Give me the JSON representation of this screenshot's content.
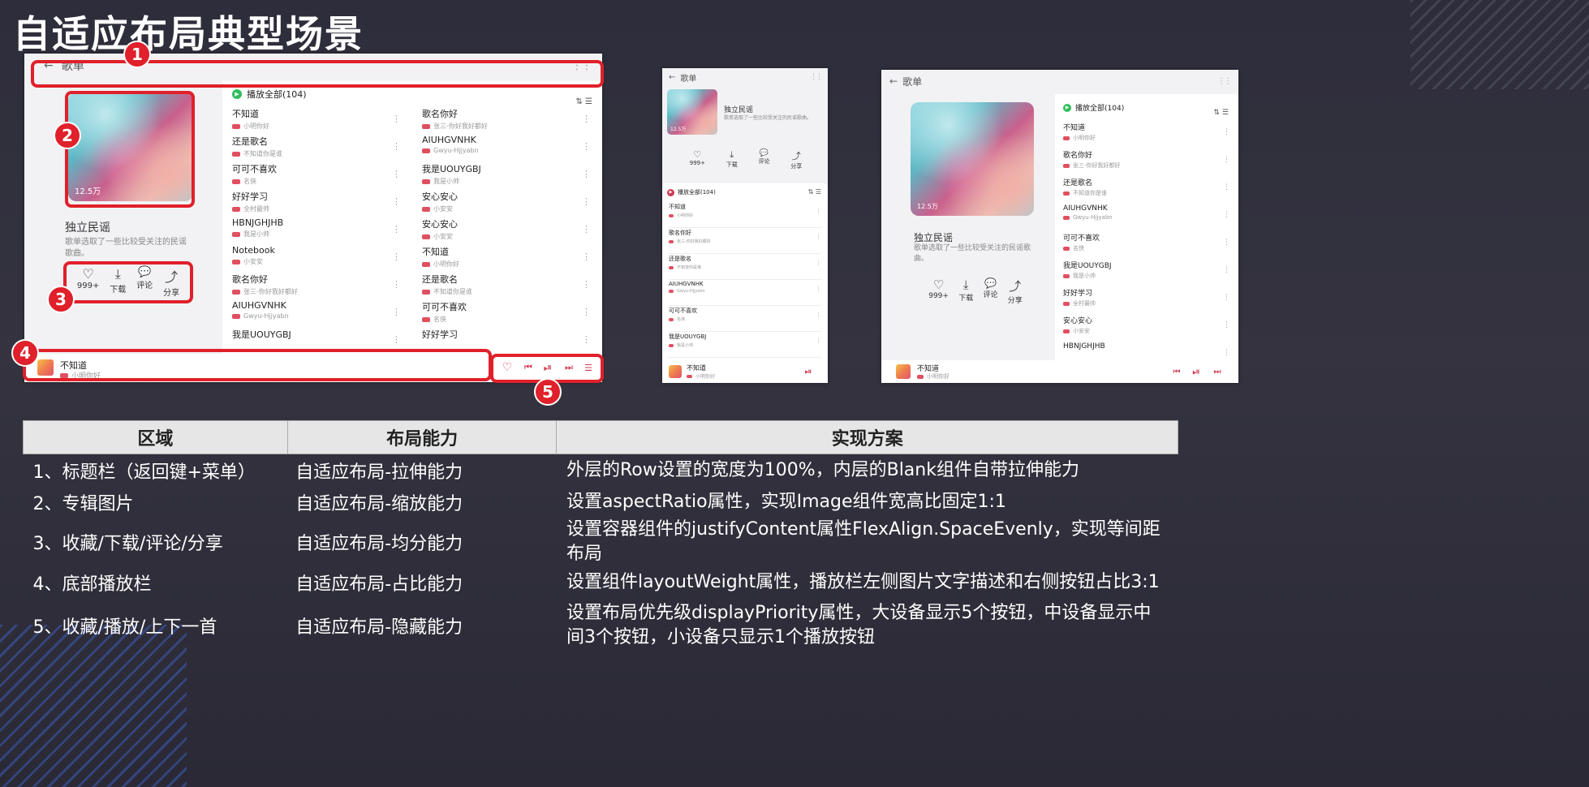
{
  "slide_title": "自适应布局典型场景",
  "large": {
    "header": {
      "back_icon": "←",
      "title": "歌单",
      "menu_icon": "⋮⋮"
    },
    "album": {
      "play_count": "12.5万",
      "name": "独立民谣",
      "desc_line1": "歌单选取了一些比较受关注的民谣",
      "desc_line2": "歌曲。"
    },
    "actions": [
      {
        "icon": "♡",
        "label": "999+"
      },
      {
        "icon": "⤓",
        "label": "下载"
      },
      {
        "icon": "💬",
        "label": "评论"
      },
      {
        "icon": "⤴",
        "label": "分享"
      }
    ],
    "play_all": "播放全部(104)",
    "list_icons": "⇅ ☰",
    "col1": [
      {
        "title": "不知道",
        "sub": "小明你好"
      },
      {
        "title": "还是歌名",
        "sub": "不知道你是谁"
      },
      {
        "title": "可可不喜欢",
        "sub": "名侠"
      },
      {
        "title": "好好学习",
        "sub": "全村最帅"
      },
      {
        "title": "HBNJGHJHB",
        "sub": "我是小帅"
      },
      {
        "title": "Notebook",
        "sub": "小安安"
      },
      {
        "title": "歌名你好",
        "sub": "张三-你好我好都好"
      },
      {
        "title": "AIUHGVNHK",
        "sub": "Gwyu-Hjjyabn"
      },
      {
        "title": "我是UOUYGBJ",
        "sub": ""
      }
    ],
    "col2": [
      {
        "title": "歌名你好",
        "sub": "张三-你好我好都好"
      },
      {
        "title": "AIUHGVNHK",
        "sub": "Gwyu-Hjjyabn"
      },
      {
        "title": "我是UOUYGBJ",
        "sub": "我是小帅"
      },
      {
        "title": "安心安心",
        "sub": "小安安"
      },
      {
        "title": "安心安心",
        "sub": "小安安"
      },
      {
        "title": "不知道",
        "sub": "小明你好"
      },
      {
        "title": "还是歌名",
        "sub": "不知道你是谁"
      },
      {
        "title": "可可不喜欢",
        "sub": "名侠"
      },
      {
        "title": "好好学习",
        "sub": ""
      }
    ],
    "player": {
      "title": "不知道",
      "sub": "小明你好"
    },
    "controls": [
      "♡",
      "⏮",
      "⏯",
      "⏭",
      "☰"
    ]
  },
  "small": {
    "header": {
      "back_icon": "←",
      "title": "歌单",
      "menu_icon": "⋮⋮"
    },
    "album": {
      "play_count": "12.5万",
      "name": "独立民谣",
      "desc": "歌单选取了一些比较受关注的民谣歌曲。"
    },
    "actions": [
      {
        "icon": "♡",
        "label": "999+"
      },
      {
        "icon": "⤓",
        "label": "下载"
      },
      {
        "icon": "💬",
        "label": "评论"
      },
      {
        "icon": "⤴",
        "label": "分享"
      }
    ],
    "play_all": "播放全部(104)",
    "list_icons": "⇅ ☰",
    "songs": [
      {
        "title": "不知道",
        "sub": "小明你好"
      },
      {
        "title": "歌名你好",
        "sub": "张三-你好我好都好"
      },
      {
        "title": "还是歌名",
        "sub": "不知道你是谁"
      },
      {
        "title": "AIUHGVNHK",
        "sub": "Gwyu-Hjjyabn"
      },
      {
        "title": "可可不喜欢",
        "sub": "名侠"
      },
      {
        "title": "我是UOUYGBJ",
        "sub": "我是小帅"
      }
    ],
    "player": {
      "title": "不知道",
      "sub": "小明你好"
    },
    "controls": [
      "⏯"
    ]
  },
  "medium": {
    "header": {
      "back_icon": "←",
      "title": "歌单",
      "menu_icon": "⋮⋮"
    },
    "album": {
      "play_count": "12.5万",
      "name": "独立民谣",
      "desc_line1": "歌单选取了一些比较受关注的民谣歌",
      "desc_line2": "曲。"
    },
    "actions": [
      {
        "icon": "♡",
        "label": "999+"
      },
      {
        "icon": "⤓",
        "label": "下载"
      },
      {
        "icon": "💬",
        "label": "评论"
      },
      {
        "icon": "⤴",
        "label": "分享"
      }
    ],
    "play_all": "播放全部(104)",
    "list_icons": "⇅ ☰",
    "songs": [
      {
        "title": "不知道",
        "sub": "小明你好"
      },
      {
        "title": "歌名你好",
        "sub": "张三-你好我好都好"
      },
      {
        "title": "还是歌名",
        "sub": "不知道你是谁"
      },
      {
        "title": "AIUHGVNHK",
        "sub": "Gwyu-Hjjyabn"
      },
      {
        "title": "可可不喜欢",
        "sub": "名侠"
      },
      {
        "title": "我是UOUYGBJ",
        "sub": "我是小帅"
      },
      {
        "title": "好好学习",
        "sub": "全村最帅"
      },
      {
        "title": "安心安心",
        "sub": "小安安"
      },
      {
        "title": "HBNJGHJHB",
        "sub": ""
      }
    ],
    "player": {
      "title": "不知道",
      "sub": "小明你好"
    },
    "controls": [
      "⏮",
      "⏯",
      "⏭"
    ]
  },
  "badges": [
    "1",
    "2",
    "3",
    "4",
    "5"
  ],
  "table": {
    "headers": [
      "区域",
      "布局能力",
      "实现方案"
    ],
    "rows": [
      [
        "1、标题栏（返回键+菜单）",
        "自适应布局-拉伸能力",
        "外层的Row设置的宽度为100%，内层的Blank组件自带拉伸能力"
      ],
      [
        "2、专辑图片",
        "自适应布局-缩放能力",
        "设置aspectRatio属性，实现Image组件宽高比固定1:1"
      ],
      [
        "3、收藏/下载/评论/分享",
        "自适应布局-均分能力",
        "设置容器组件的justifyContent属性FlexAlign.SpaceEvenly，实现等间距布局"
      ],
      [
        "4、底部播放栏",
        "自适应布局-占比能力",
        "设置组件layoutWeight属性，播放栏左侧图片文字描述和右侧按钮占比3:1"
      ],
      [
        "5、收藏/播放/上下一首",
        "自适应布局-隐藏能力",
        "设置布局优先级displayPriority属性，大设备显示5个按钮，中设备显示中间3个按钮，小设备只显示1个播放按钮"
      ]
    ]
  },
  "colors": {
    "accent_red": "#e0202a",
    "play_green": "#2fbf5a",
    "play_red": "#d23a52"
  }
}
